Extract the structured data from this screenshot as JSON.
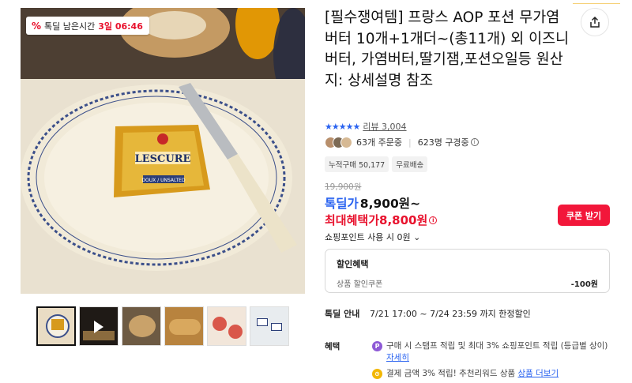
{
  "timer": {
    "icon": "percent-icon",
    "label": "톡딜 남은시간",
    "time": "3일 06:46"
  },
  "product": {
    "title": "[필수쟁여템] 프랑스 AOP 포션 무가염 버터 10개+1개더~(총11개) 외 이즈니버터, 가염버터,딸기잼,포션오일등 원산지: 상세설명 참조",
    "stars": "★★★★★",
    "review_label": "리뷰 3,004",
    "orders": "63개 주문중",
    "viewers": "623명 구경중",
    "tags": [
      "누적구매 50,177",
      "무료배송"
    ],
    "butter_label_top": "LESCURE",
    "butter_label_bottom": "DOUX / UNSALTED"
  },
  "price": {
    "original": "19,900원",
    "deal_label": "톡딜가",
    "deal_value": "8,900원~",
    "max_label": "최대혜택가",
    "max_value": "8,800원",
    "coupon_button": "쿠폰 받기",
    "points_label": "쇼핑포인트 사용 시 0원"
  },
  "discount": {
    "header": "할인혜택",
    "item_label": "상품 할인쿠폰",
    "item_amount": "-100원"
  },
  "deal_info": {
    "key": "톡딜 안내",
    "value": "7/21 17:00 ~ 7/24 23:59 까지 한정할인"
  },
  "benefit": {
    "key": "혜택",
    "item1_text": "구매 시 스탬프 적립 및 최대 3% 쇼핑포인트 적립 (등급별 상이)",
    "item1_link": "자세히",
    "item2_text": "결제 금액 3% 적립! 추천리워드 상품",
    "item2_link": "상품 더보기"
  },
  "thumbnails": [
    {
      "name": "thumb-butter-plate",
      "color": "#e9dcc4"
    },
    {
      "name": "thumb-video",
      "color": "#1f1a16"
    },
    {
      "name": "thumb-bread",
      "color": "#6d5a43"
    },
    {
      "name": "thumb-croissants",
      "color": "#b8833e"
    },
    {
      "name": "thumb-strawberry-toast",
      "color": "#d9574a"
    },
    {
      "name": "thumb-butter-pieces",
      "color": "#e8ecef"
    }
  ],
  "colors": {
    "accent_blue": "#2a63f0",
    "accent_red": "#e8112d",
    "coupon_red": "#f2173a"
  }
}
